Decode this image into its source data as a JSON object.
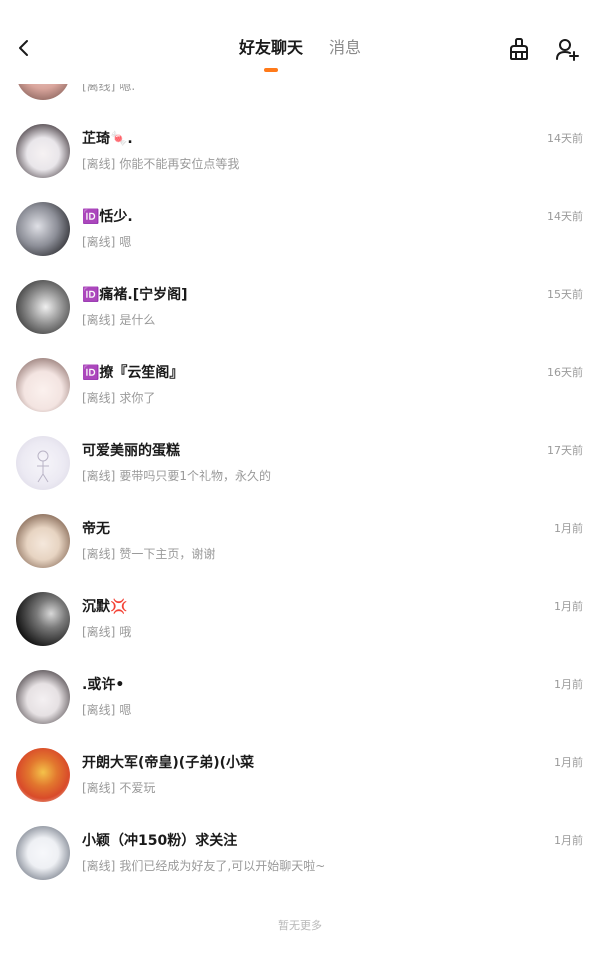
{
  "header": {
    "tabs": [
      {
        "label": "好友聊天",
        "active": true
      },
      {
        "label": "消息",
        "active": false
      }
    ],
    "accent_color": "#ff7a1a"
  },
  "list": {
    "items": [
      {
        "name": "",
        "status": "[离线]",
        "message": "嗯.",
        "time": "",
        "avatar_colors": [
          "#f2d3cf",
          "#6b4a44"
        ]
      },
      {
        "name": "芷琦🍬.",
        "status": "[离线]",
        "message": "你能不能再安位点等我",
        "time": "14天前",
        "avatar_colors": [
          "#e9e6ea",
          "#3a3035"
        ]
      },
      {
        "name": "🆔恬少.",
        "status": "[离线]",
        "message": "嗯",
        "time": "14天前",
        "avatar_colors": [
          "#bfc2c9",
          "#1e1e22"
        ]
      },
      {
        "name": "🆔痛褚.[宁岁阁]",
        "status": "[离线]",
        "message": "是什么",
        "time": "15天前",
        "avatar_colors": [
          "#cfcfcf",
          "#2b2b2b"
        ]
      },
      {
        "name": "🆔撩『云笙阁』",
        "status": "[离线]",
        "message": "求你了",
        "time": "16天前",
        "avatar_colors": [
          "#f3e4e1",
          "#7a5b56"
        ]
      },
      {
        "name": "可爱美丽的蛋糕",
        "status": "[离线]",
        "message": "要带吗只要1个礼物，永久的",
        "time": "17天前",
        "avatar_colors": [
          "#eceaf3",
          "#b9b4c6"
        ]
      },
      {
        "name": "帝无",
        "status": "[离线]",
        "message": "赞一下主页，谢谢",
        "time": "1月前",
        "avatar_colors": [
          "#e7d4c2",
          "#6d4e3b"
        ]
      },
      {
        "name": "沉默💢",
        "status": "[离线]",
        "message": "哦",
        "time": "1月前",
        "avatar_colors": [
          "#9a9a9a",
          "#151515"
        ]
      },
      {
        "name": ".或许•",
        "status": "[离线]",
        "message": "嗯",
        "time": "1月前",
        "avatar_colors": [
          "#e6e1e3",
          "#3b3438"
        ]
      },
      {
        "name": "开朗大军(帝皇)(子弟)(小菜",
        "status": "[离线]",
        "message": "不爱玩",
        "time": "1月前",
        "avatar_colors": [
          "#d94b2a",
          "#f4c24a"
        ]
      },
      {
        "name": "小颖（冲150粉）求关注",
        "status": "[离线]",
        "message": "我们已经成为好友了,可以开始聊天啦~",
        "time": "1月前",
        "avatar_colors": [
          "#eef0f4",
          "#58606e"
        ]
      }
    ]
  },
  "footer": {
    "text": "暂无更多"
  }
}
